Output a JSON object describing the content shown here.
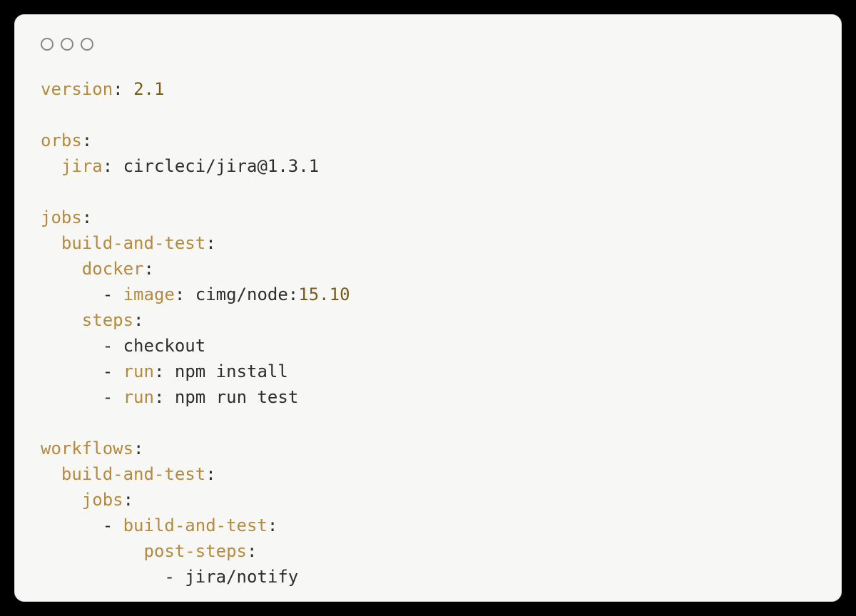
{
  "yaml": {
    "version_key": "version",
    "version_val": "2.1",
    "orbs_key": "orbs",
    "jira_key": "jira",
    "jira_val": "circleci/jira@1.3.1",
    "jobs_key": "jobs",
    "build_test_key": "build-and-test",
    "docker_key": "docker",
    "image_key": "image",
    "image_val_prefix": "cimg/node:",
    "image_val_num": "15.10",
    "steps_key": "steps",
    "checkout": "checkout",
    "run_key": "run",
    "npm_install": "npm install",
    "npm_test": "npm run test",
    "workflows_key": "workflows",
    "wf_build_test_key": "build-and-test",
    "wf_jobs_key": "jobs",
    "wf_build_test_item": "build-and-test",
    "post_steps_key": "post-steps",
    "jira_notify": "jira/notify"
  }
}
